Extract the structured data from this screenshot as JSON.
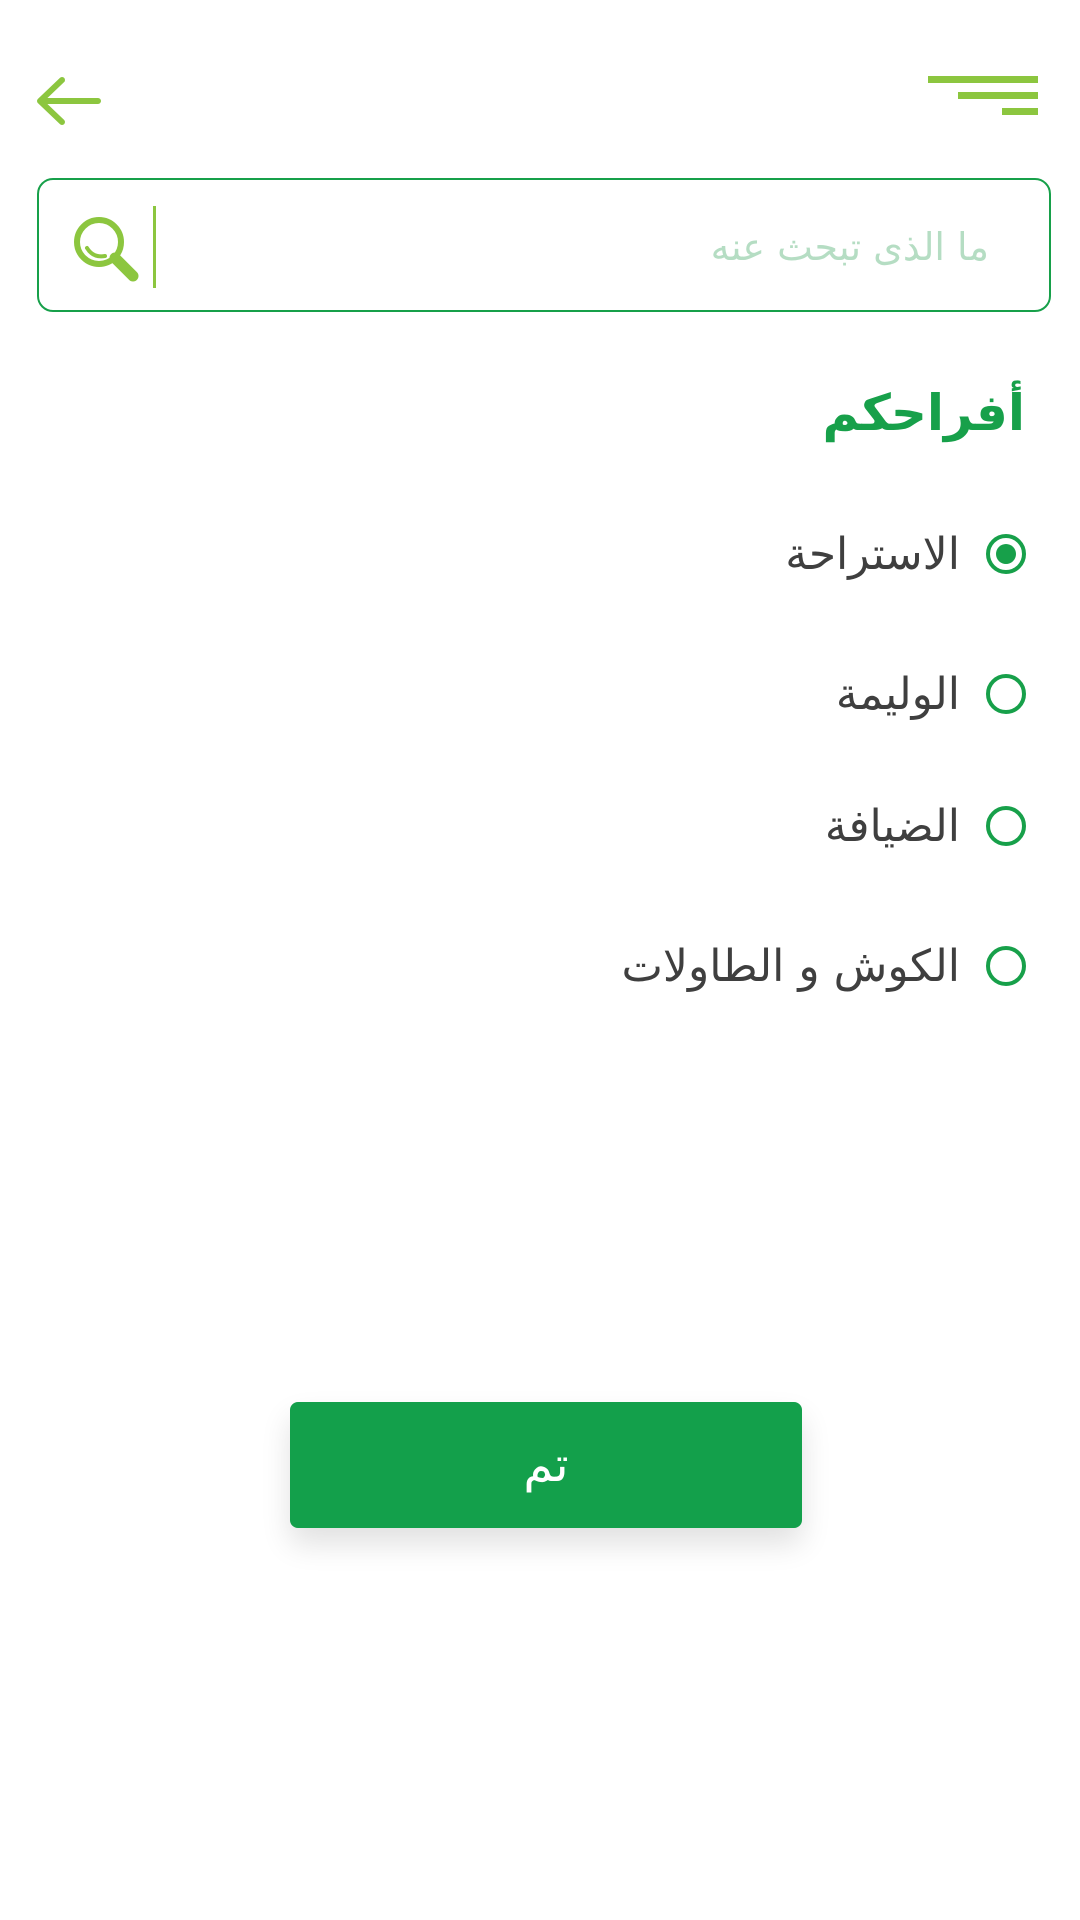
{
  "header": {
    "back_icon": "arrow-left-icon",
    "menu_icon": "hamburger-menu-icon",
    "accent_color": "#8cc63f"
  },
  "search": {
    "placeholder": "ما الذى تبحث عنه",
    "value": "",
    "icon": "search-icon",
    "border_color": "#17a04a"
  },
  "section": {
    "title": "أفراحكم",
    "color": "#17a04a"
  },
  "options": [
    {
      "label": "الاستراحة",
      "checked": true
    },
    {
      "label": "الوليمة",
      "checked": false
    },
    {
      "label": "الضيافة",
      "checked": false
    },
    {
      "label": "الكوش و الطاولات",
      "checked": false
    }
  ],
  "done_button": {
    "label": "تم",
    "color": "#13a04b"
  }
}
